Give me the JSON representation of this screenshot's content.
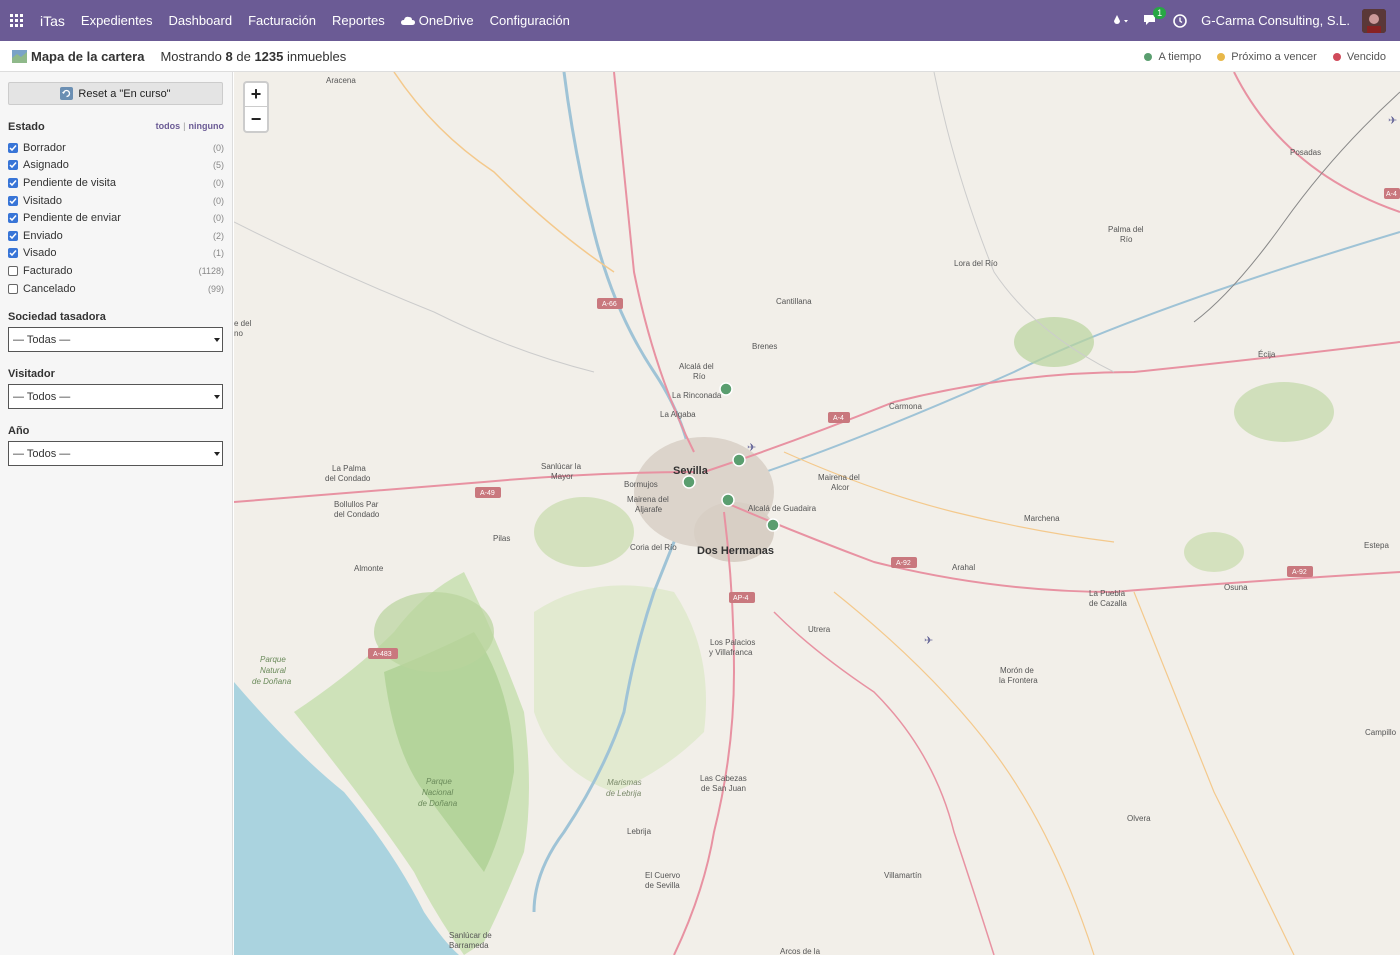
{
  "navbar": {
    "brand": "iTas",
    "menu": [
      "Expedientes",
      "Dashboard",
      "Facturación",
      "Reportes",
      "OneDrive",
      "Configuración"
    ],
    "notifications_count": "1",
    "company": "G-Carma Consulting, S.L."
  },
  "subheader": {
    "title": "Mapa de la cartera",
    "showing_prefix": "Mostrando",
    "showing_count": "8",
    "showing_middle": "de",
    "showing_total": "1235",
    "showing_suffix": "inmuebles",
    "legend": [
      {
        "label": "A tiempo",
        "color": "#5a9e6f"
      },
      {
        "label": "Próximo a vencer",
        "color": "#e8b84a"
      },
      {
        "label": "Vencido",
        "color": "#d04a5a"
      }
    ]
  },
  "sidebar": {
    "reset_label": "Reset a \"En curso\"",
    "estado_title": "Estado",
    "all_link": "todos",
    "none_link": "ninguno",
    "estados": [
      {
        "label": "Borrador",
        "count": "(0)",
        "checked": true
      },
      {
        "label": "Asignado",
        "count": "(5)",
        "checked": true
      },
      {
        "label": "Pendiente de visita",
        "count": "(0)",
        "checked": true
      },
      {
        "label": "Visitado",
        "count": "(0)",
        "checked": true
      },
      {
        "label": "Pendiente de enviar",
        "count": "(0)",
        "checked": true
      },
      {
        "label": "Enviado",
        "count": "(2)",
        "checked": true
      },
      {
        "label": "Visado",
        "count": "(1)",
        "checked": true
      },
      {
        "label": "Facturado",
        "count": "(1128)",
        "checked": false
      },
      {
        "label": "Cancelado",
        "count": "(99)",
        "checked": false
      }
    ],
    "sociedad_title": "Sociedad tasadora",
    "sociedad_value": "— Todas —",
    "visitador_title": "Visitador",
    "visitador_value": "— Todos —",
    "anio_title": "Año",
    "anio_value": "— Todos —"
  },
  "map": {
    "zoom_in": "+",
    "zoom_out": "−",
    "places": [
      "Aracena",
      "Posadas",
      "Palma del Río",
      "Lora del Río",
      "Cantillana",
      "Brenes",
      "Alcalá del Río",
      "La Rinconada",
      "La Algaba",
      "Carmona",
      "Sanlúcar la Mayor",
      "Sevilla",
      "Bormujos",
      "Mairena del Aljarafe",
      "Mairena del Alcor",
      "Alcalá de Guadaira",
      "Dos Hermanas",
      "Coria del Río",
      "La Palma del Condado",
      "Bollullos Par del Condado",
      "Pilas",
      "Almonte",
      "Écija",
      "Marchena",
      "Arahal",
      "La Puebla de Cazalla",
      "Osuna",
      "Estepa",
      "Utrera",
      "Los Palacios y Villafranca",
      "Morón de la Frontera",
      "Parque Natural de Doñana",
      "Parque Nacional de Doñana",
      "Marismas de Lebrija",
      "Las Cabezas de San Juan",
      "Lebrija",
      "El Cuervo de Sevilla",
      "Villamartín",
      "Olvera",
      "Campillo",
      "Sanlúcar de Barrameda",
      "Arcos de la",
      "e del no"
    ],
    "roads": [
      "A-66",
      "A-4",
      "A-49",
      "A-92",
      "AP-4",
      "A-483",
      "A-4",
      "A-92"
    ],
    "marker_color": "#5a9e6f"
  }
}
